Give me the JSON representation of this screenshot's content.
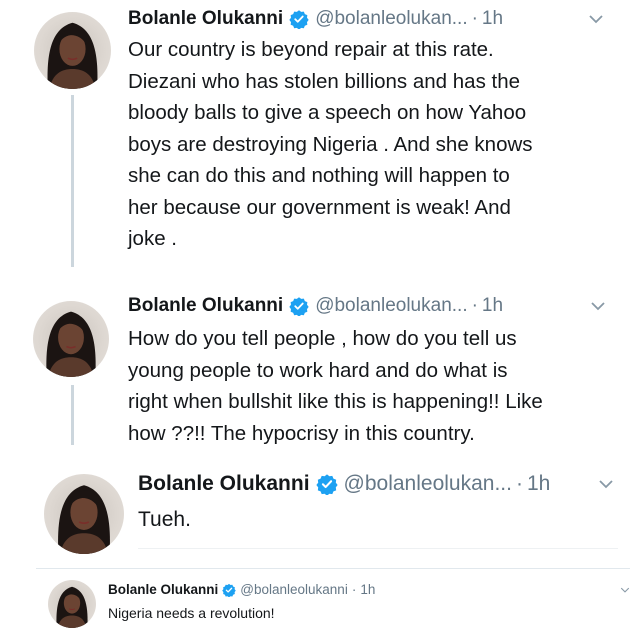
{
  "tweets": [
    {
      "name": "Bolanle Olukanni",
      "handle": "@bolanleolukan...",
      "dot": "·",
      "time": "1h",
      "text": "Our country is beyond repair at this rate.\nDiezani who has stolen billions and has the\nbloody balls to give a speech on how Yahoo\nboys are destroying Nigeria . And she knows\nshe can do this and nothing will happen to\nher because our government is weak! And\njoke .",
      "avatar_icon": "profile-photo",
      "verified_icon": "verified-badge-icon",
      "menu_icon": "chevron-down-icon"
    },
    {
      "name": "Bolanle Olukanni",
      "handle": "@bolanleolukan...",
      "dot": "·",
      "time": "1h",
      "text": "How do you tell people , how do you tell us\nyoung people to work hard and do what is\nright when bullshit like this is happening!! Like\nhow ??!! The hypocrisy in this country.",
      "avatar_icon": "profile-photo",
      "verified_icon": "verified-badge-icon",
      "menu_icon": "chevron-down-icon"
    },
    {
      "name": "Bolanle Olukanni",
      "handle": "@bolanleolukan...",
      "dot": "·",
      "time": "1h",
      "text": "Tueh.",
      "avatar_icon": "profile-photo",
      "verified_icon": "verified-badge-icon",
      "menu_icon": "chevron-down-icon"
    },
    {
      "name": "Bolanle Olukanni",
      "handle": "@bolanleolukanni",
      "dot": "·",
      "time": "1h",
      "text": "Nigeria needs a revolution!",
      "avatar_icon": "profile-photo",
      "verified_icon": "verified-badge-icon",
      "menu_icon": "chevron-down-icon"
    }
  ],
  "colors": {
    "verified": "#1da1f2",
    "text": "#14171a",
    "secondary": "#657786",
    "thread_line": "#ccd6dd"
  }
}
